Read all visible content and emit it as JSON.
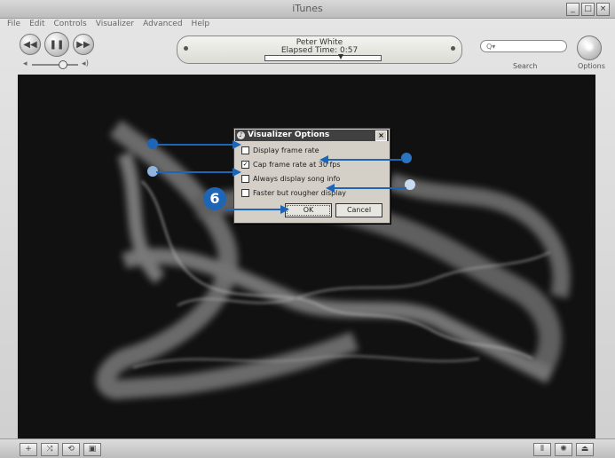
{
  "window": {
    "title": "iTunes",
    "controls": [
      "_",
      "□",
      "×"
    ]
  },
  "menubar": [
    "File",
    "Edit",
    "Controls",
    "Visualizer",
    "Advanced",
    "Help"
  ],
  "transport": {
    "prev": "◀◀",
    "play": "❚❚",
    "next": "▶▶"
  },
  "lcd": {
    "line1": "Peter White",
    "line2": "Elapsed Time: 0:57",
    "progress": 0.65
  },
  "search": {
    "placeholder": "Q▾",
    "label": "Search"
  },
  "options": {
    "label": "Options"
  },
  "dialog": {
    "title": "Visualizer Options",
    "options": [
      {
        "label": "Display frame rate",
        "checked": false
      },
      {
        "label": "Cap frame rate at 30 fps",
        "checked": true
      },
      {
        "label": "Always display song info",
        "checked": false
      },
      {
        "label": "Faster but rougher display",
        "checked": false
      }
    ],
    "ok_label": "OK",
    "cancel_label": "Cancel"
  },
  "callout": {
    "step": "6",
    "color": "#1e66b5"
  },
  "bottombar": {
    "add": "+",
    "shuffle": "⤨",
    "repeat": "⟲",
    "artwork": "▣",
    "equalizer": "⦀",
    "visualizer": "✺",
    "eject": "⏏"
  }
}
